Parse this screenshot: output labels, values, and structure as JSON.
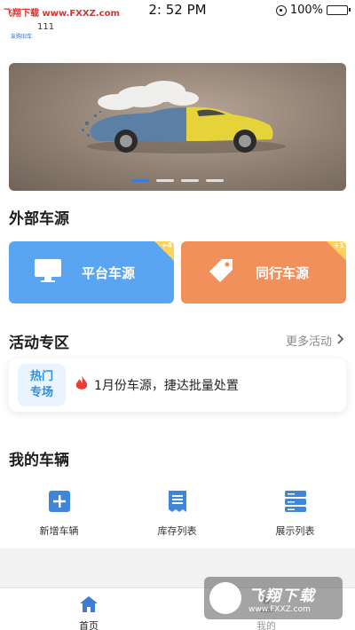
{
  "status_bar": {
    "watermark": "飞翔下载 www.FXXZ.com",
    "time": "2: 52 PM",
    "battery": "100%"
  },
  "brand": {
    "logo_text": "友购旧车",
    "number": "111"
  },
  "banner": {
    "slides_count": 4,
    "active_slide": 1
  },
  "external_sources": {
    "title": "外部车源",
    "cards": [
      {
        "label": "平台车源",
        "badge": "+4",
        "color": "#5aa5f1"
      },
      {
        "label": "同行车源",
        "badge": "+1",
        "color": "#f2905b"
      }
    ]
  },
  "activity": {
    "title": "活动专区",
    "more_label": "更多活动",
    "badge_line1": "热门",
    "badge_line2": "专场",
    "item_text": "1月份车源，捷达批量处置"
  },
  "my_vehicles": {
    "title": "我的车辆",
    "actions": [
      {
        "label": "新增车辆",
        "icon": "add-square-icon"
      },
      {
        "label": "库存列表",
        "icon": "receipt-list-icon"
      },
      {
        "label": "展示列表",
        "icon": "server-stack-icon"
      }
    ]
  },
  "tabbar": {
    "tabs": [
      {
        "label": "首页",
        "icon": "home-icon",
        "active": true
      },
      {
        "label": "我的",
        "icon": "user-icon",
        "active": false
      }
    ]
  },
  "watermark": {
    "text": "飞翔下载",
    "url": "www.FXXZ.com"
  },
  "colors": {
    "accent_blue": "#3e7bd6",
    "card_blue": "#5aa5f1",
    "card_orange": "#f2905b",
    "hot_text": "#2f8fe2"
  }
}
